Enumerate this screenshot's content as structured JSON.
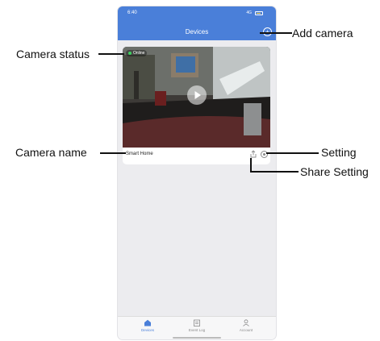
{
  "status_bar": {
    "time": "6:40",
    "network": "4G"
  },
  "header": {
    "title": "Devices",
    "add_symbol": "+"
  },
  "camera_card": {
    "status": "Online",
    "name": "Smart Home"
  },
  "tabbar": {
    "tabs": [
      {
        "label": "Devices",
        "icon": "home-icon",
        "active": true
      },
      {
        "label": "Event Log",
        "icon": "event-log-icon",
        "active": false
      },
      {
        "label": "Account",
        "icon": "account-icon",
        "active": false
      }
    ]
  },
  "callouts": {
    "add_camera": "Add camera",
    "camera_status": "Camera status",
    "camera_name": "Camera name",
    "setting": "Setting",
    "share_setting": "Share Setting"
  },
  "colors": {
    "header": "#4a7fd9",
    "online": "#3ecf5f",
    "background": "#ececef"
  }
}
